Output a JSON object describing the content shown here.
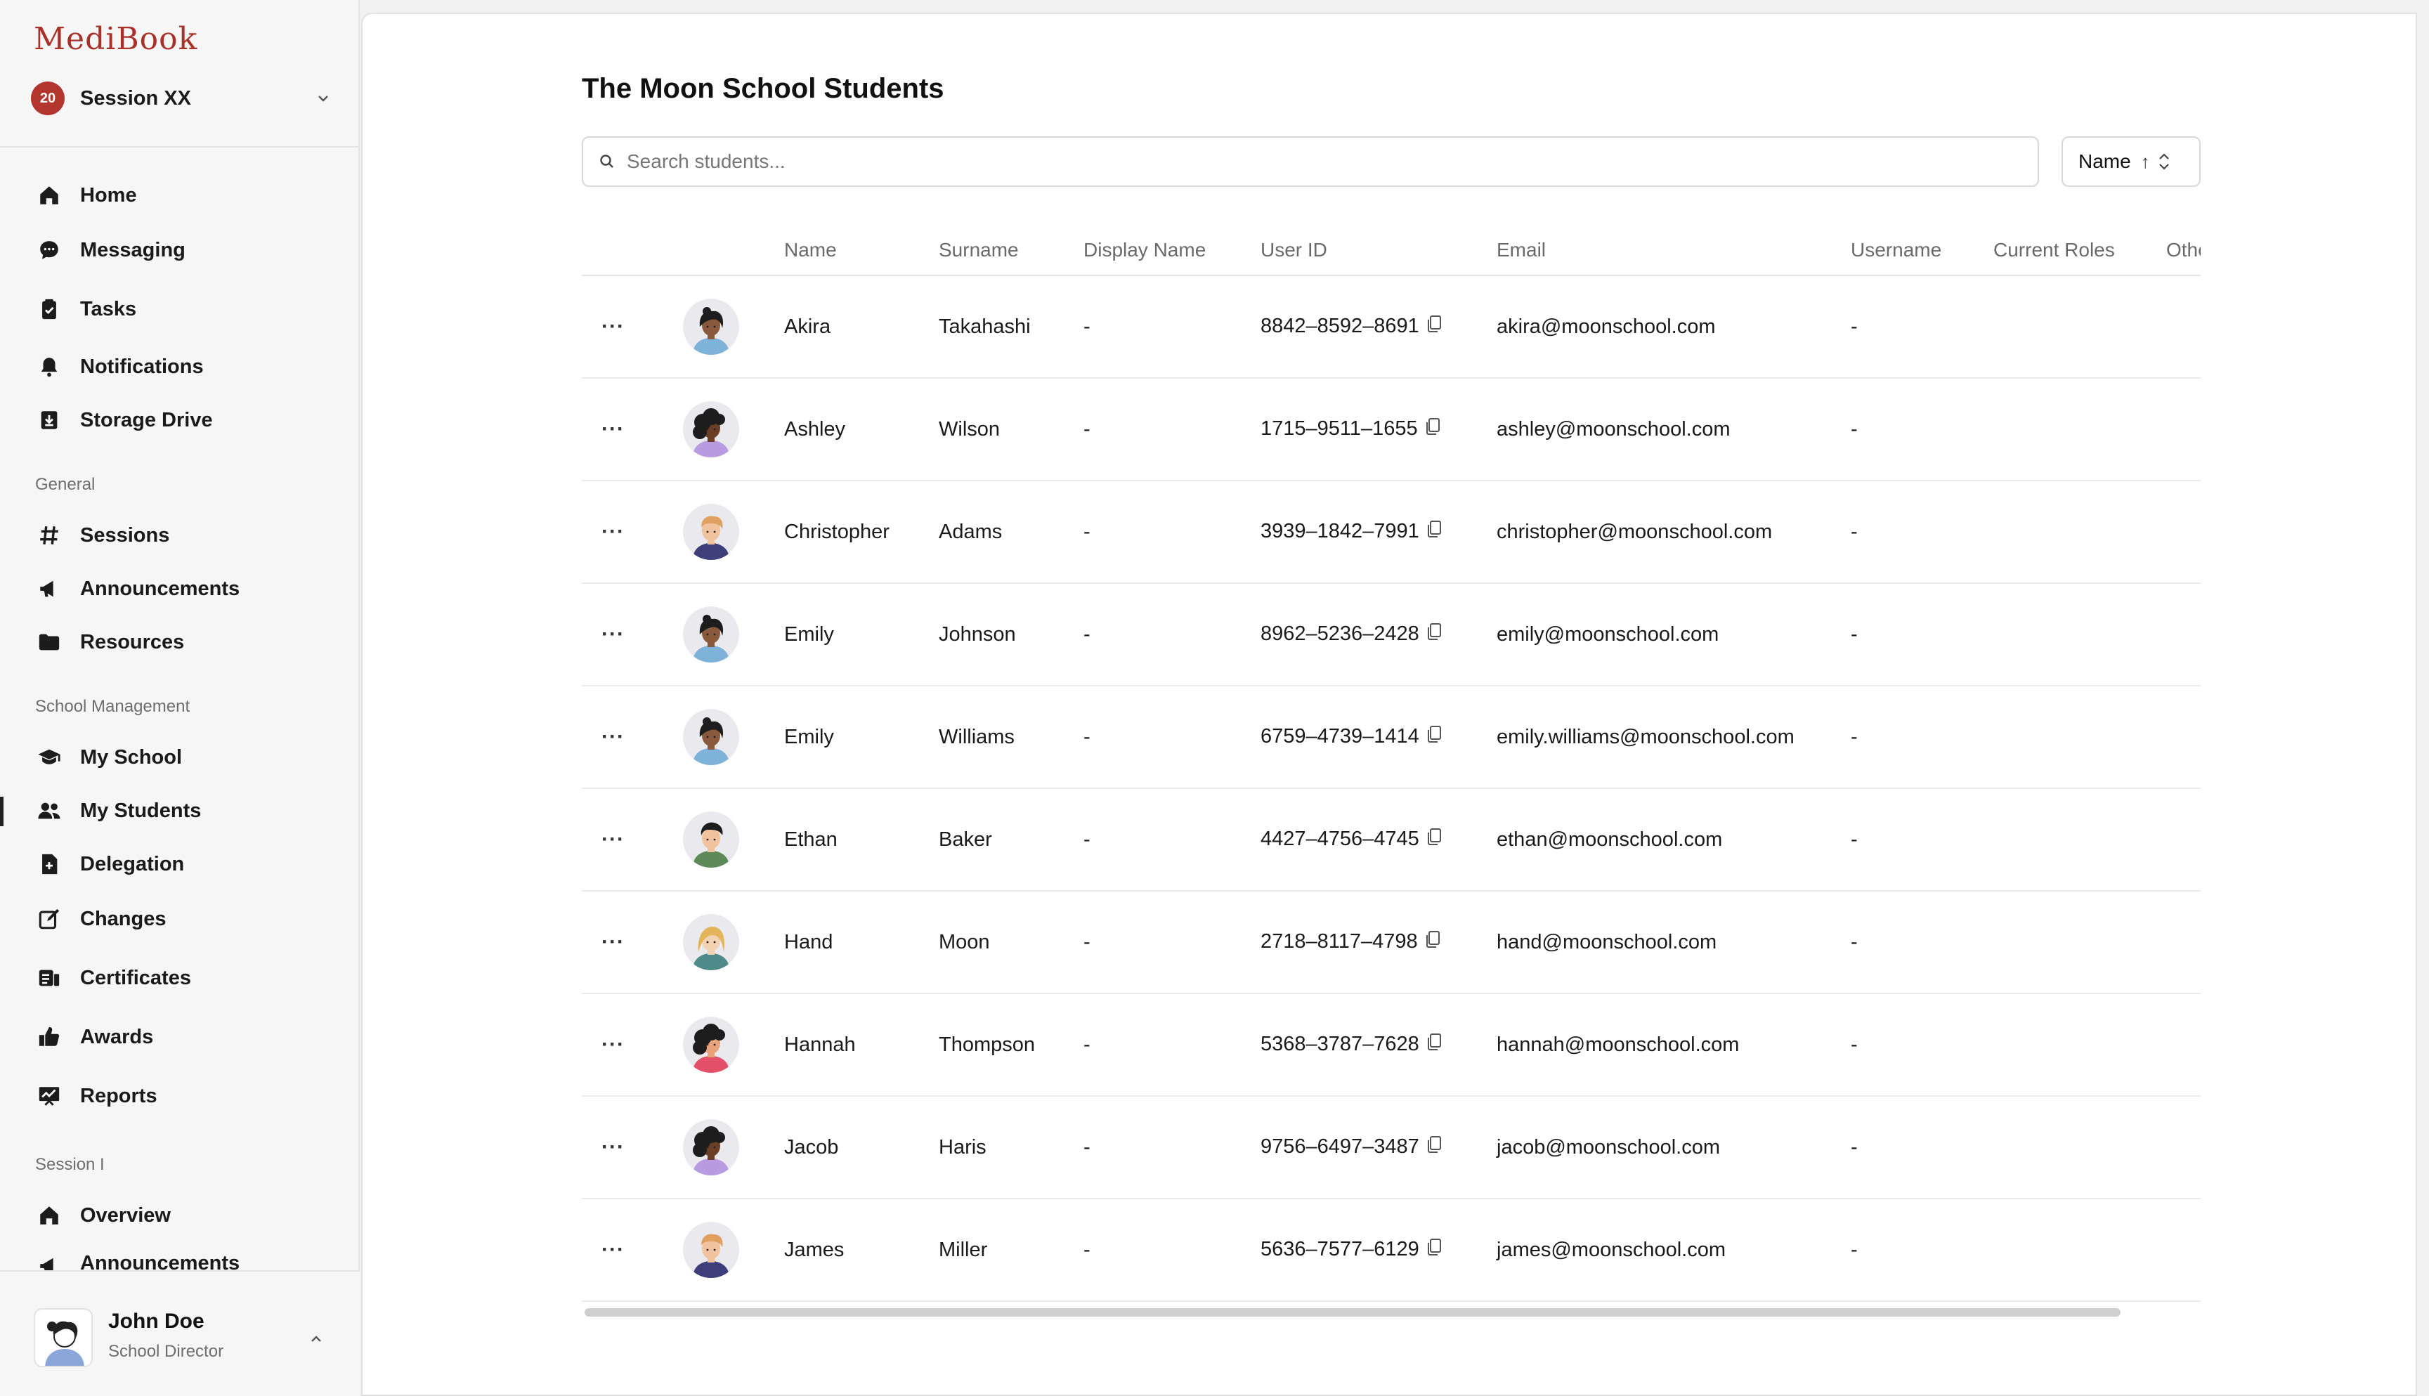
{
  "app": {
    "brand": "MediBook"
  },
  "session": {
    "badge": "20",
    "name": "Session XX"
  },
  "nav": {
    "main": [
      "Home",
      "Messaging",
      "Tasks",
      "Notifications",
      "Storage Drive"
    ],
    "general_title": "General",
    "general": [
      "Sessions",
      "Announcements",
      "Resources"
    ],
    "school_title": "School Management",
    "school": [
      "My School",
      "My Students",
      "Delegation",
      "Changes",
      "Certificates",
      "Awards",
      "Reports"
    ],
    "session_title": "Session I",
    "session_items": [
      "Overview",
      "Announcements"
    ]
  },
  "user": {
    "name": "John Doe",
    "role": "School Director"
  },
  "page": {
    "title": "The Moon School Students",
    "search_placeholder": "Search students...",
    "sort_label": "Name"
  },
  "table": {
    "columns": [
      "Name",
      "Surname",
      "Display Name",
      "User ID",
      "Email",
      "Username",
      "Current Roles",
      "Other"
    ],
    "rows": [
      {
        "name": "Akira",
        "surname": "Takahashi",
        "display": "-",
        "id": "8842–8592–8691",
        "email": "akira@moonschool.com",
        "username": "-",
        "avatar": "female-short-hair",
        "shirt": "#7fb2d8",
        "skin": "#8a5a3c",
        "hair": "#1d1d1d"
      },
      {
        "name": "Ashley",
        "surname": "Wilson",
        "display": "-",
        "id": "1715–9511–1655",
        "email": "ashley@moonschool.com",
        "username": "-",
        "avatar": "female-curly-hair",
        "shirt": "#b89ae0",
        "skin": "#6b3f26",
        "hair": "#1d1d1d"
      },
      {
        "name": "Christopher",
        "surname": "Adams",
        "display": "-",
        "id": "3939–1842–7991",
        "email": "christopher@moonschool.com",
        "username": "-",
        "avatar": "male-blond-hair",
        "shirt": "#3d3f7a",
        "skin": "#f0c39e",
        "hair": "#e0a060"
      },
      {
        "name": "Emily",
        "surname": "Johnson",
        "display": "-",
        "id": "8962–5236–2428",
        "email": "emily@moonschool.com",
        "username": "-",
        "avatar": "female-short-hair",
        "shirt": "#7fb2d8",
        "skin": "#8a5a3c",
        "hair": "#1d1d1d"
      },
      {
        "name": "Emily",
        "surname": "Williams",
        "display": "-",
        "id": "6759–4739–1414",
        "email": "emily.williams@moonschool.com",
        "username": "-",
        "avatar": "female-short-hair",
        "shirt": "#7fb2d8",
        "skin": "#8a5a3c",
        "hair": "#1d1d1d"
      },
      {
        "name": "Ethan",
        "surname": "Baker",
        "display": "-",
        "id": "4427–4756–4745",
        "email": "ethan@moonschool.com",
        "username": "-",
        "avatar": "male-dark-hair",
        "shirt": "#5d8a58",
        "skin": "#f0c39e",
        "hair": "#1d1d1d"
      },
      {
        "name": "Hand",
        "surname": "Moon",
        "display": "-",
        "id": "2718–8117–4798",
        "email": "hand@moonschool.com",
        "username": "-",
        "avatar": "female-blond-hair",
        "shirt": "#4f8a8a",
        "skin": "#f3d2b3",
        "hair": "#e3b45a"
      },
      {
        "name": "Hannah",
        "surname": "Thompson",
        "display": "-",
        "id": "5368–3787–7628",
        "email": "hannah@moonschool.com",
        "username": "-",
        "avatar": "female-curly-hair",
        "shirt": "#e4506a",
        "skin": "#e9a37a",
        "hair": "#1d1d1d"
      },
      {
        "name": "Jacob",
        "surname": "Haris",
        "display": "-",
        "id": "9756–6497–3487",
        "email": "jacob@moonschool.com",
        "username": "-",
        "avatar": "female-curly-hair",
        "shirt": "#b89ae0",
        "skin": "#6b3f26",
        "hair": "#1d1d1d"
      },
      {
        "name": "James",
        "surname": "Miller",
        "display": "-",
        "id": "5636–7577–6129",
        "email": "james@moonschool.com",
        "username": "-",
        "avatar": "male-blond-hair",
        "shirt": "#3d3f7a",
        "skin": "#f0c39e",
        "hair": "#e0a060"
      }
    ]
  },
  "icons": {
    "nav_main": [
      "home-icon",
      "chat-bubble-icon",
      "clipboard-check-icon",
      "bell-icon",
      "download-drive-icon"
    ],
    "nav_general": [
      "hashtag-icon",
      "megaphone-icon",
      "folder-icon"
    ],
    "nav_school": [
      "graduation-cap-icon",
      "users-icon",
      "file-plus-icon",
      "edit-icon",
      "id-card-icon",
      "thumbs-up-icon",
      "chart-board-icon"
    ],
    "nav_session": [
      "home-icon",
      "megaphone-icon"
    ]
  },
  "colors": {
    "brand": "#a8322a",
    "badge": "#b3362e"
  }
}
